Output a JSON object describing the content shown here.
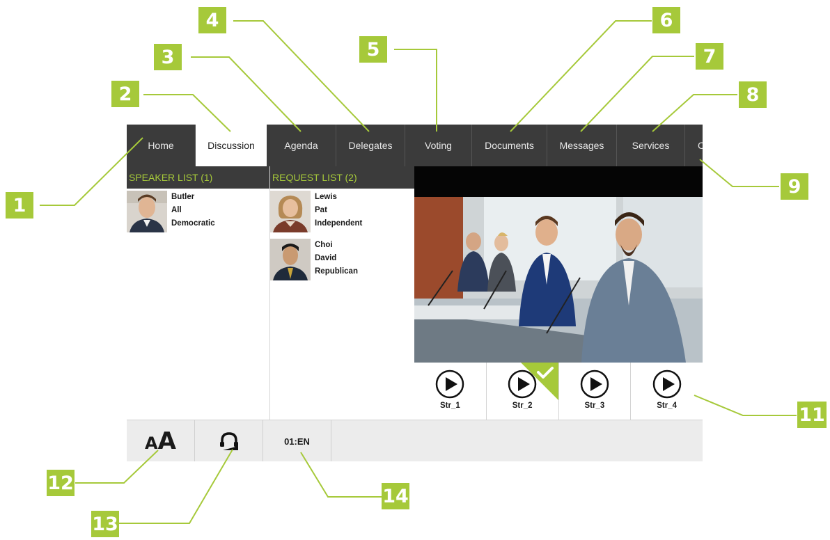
{
  "tabs": [
    {
      "label": "Home"
    },
    {
      "label": "Discussion",
      "active": true
    },
    {
      "label": "Agenda"
    },
    {
      "label": "Delegates"
    },
    {
      "label": "Voting"
    },
    {
      "label": "Documents"
    },
    {
      "label": "Messages"
    },
    {
      "label": "Services"
    },
    {
      "label": "C"
    }
  ],
  "speaker_list": {
    "title": "SPEAKER LIST (1)",
    "entries": [
      {
        "last": "Butler",
        "first": "All",
        "party": "Democratic"
      }
    ]
  },
  "request_list": {
    "title": "REQUEST LIST (2)",
    "entries": [
      {
        "last": "Lewis",
        "first": "Pat",
        "party": "Independent"
      },
      {
        "last": "Choi",
        "first": "David",
        "party": "Republican"
      }
    ]
  },
  "streams": [
    {
      "label": "Str_1",
      "selected": false
    },
    {
      "label": "Str_2",
      "selected": true
    },
    {
      "label": "Str_3",
      "selected": false
    },
    {
      "label": "Str_4",
      "selected": false
    }
  ],
  "bottom_bar": {
    "font_size_icon": "font-size-icon",
    "headphone_icon": "headphone-icon",
    "font_small_glyph": "A",
    "font_large_glyph": "A",
    "language": "01:EN"
  },
  "callouts": [
    "1",
    "2",
    "3",
    "4",
    "5",
    "6",
    "7",
    "8",
    "9",
    "11",
    "12",
    "13",
    "14"
  ],
  "colors": {
    "accent": "#a6c93a",
    "bar": "#3b3b3b",
    "bottom": "#ececec"
  }
}
